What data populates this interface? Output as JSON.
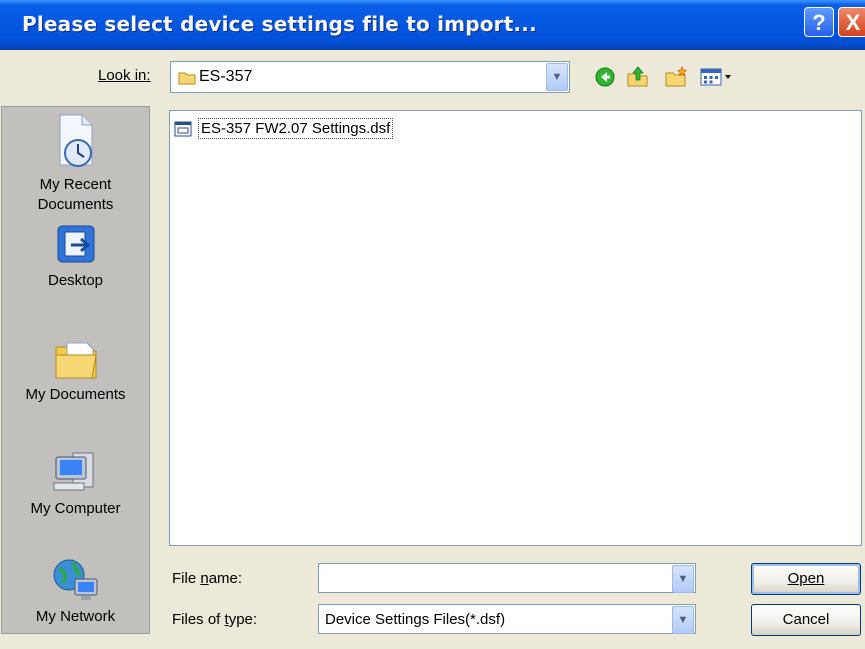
{
  "window": {
    "title": "Please select device settings file to import...",
    "help_label": "?",
    "close_label": "X"
  },
  "lookin": {
    "label": "Look in:",
    "value": "ES-357"
  },
  "toolbar": {
    "icons": [
      "back-icon",
      "up-folder-icon",
      "new-folder-icon",
      "view-menu-icon"
    ]
  },
  "places": [
    {
      "label": "My Recent\nDocuments",
      "icon": "recent-documents-icon"
    },
    {
      "label": "Desktop",
      "icon": "desktop-icon"
    },
    {
      "label": "My Documents",
      "icon": "my-documents-icon"
    },
    {
      "label": "My Computer",
      "icon": "my-computer-icon"
    },
    {
      "label": "My Network",
      "icon": "my-network-icon"
    }
  ],
  "files": [
    {
      "name": "ES-357 FW2.07 Settings.dsf"
    }
  ],
  "filename": {
    "label": "File name:",
    "value": ""
  },
  "filetype": {
    "label": "Files of type:",
    "value": "Device Settings Files(*.dsf)"
  },
  "buttons": {
    "open": "Open",
    "cancel": "Cancel"
  },
  "colors": {
    "titlebar": "#0457e0",
    "dialog_bg": "#ece9d8",
    "places_bg": "#c1c0bc"
  }
}
